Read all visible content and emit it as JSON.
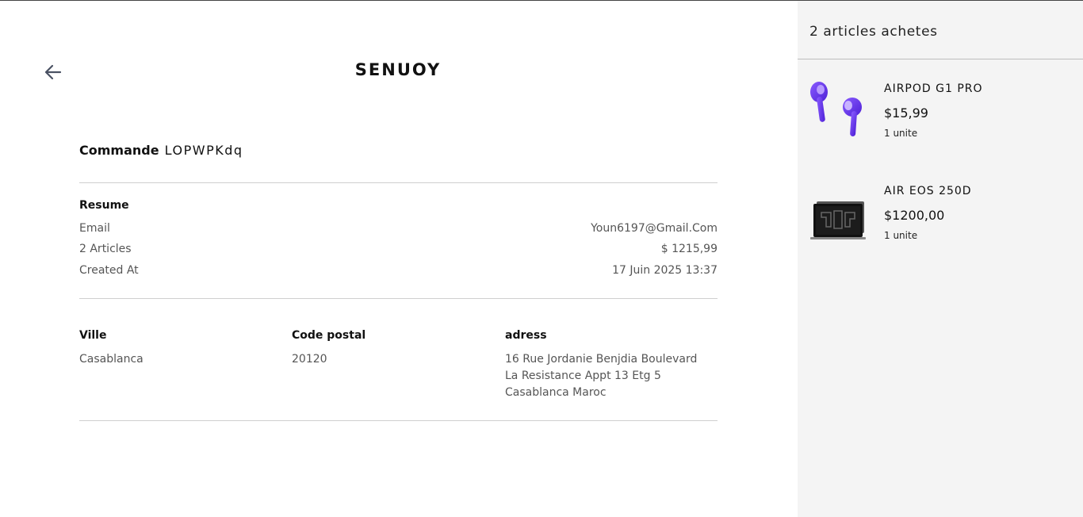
{
  "brand": "SENUOY",
  "order": {
    "label": "Commande",
    "number": "LOPWPKdq"
  },
  "summary": {
    "title": "Resume",
    "rows": [
      {
        "label": "Email",
        "value": "Youn6197@Gmail.Com"
      },
      {
        "label": "2 Articles",
        "value": "$ 1215,99"
      },
      {
        "label": "Created At",
        "value": "17 Juin 2025 13:37"
      }
    ]
  },
  "address": {
    "city_label": "Ville",
    "city": "Casablanca",
    "postal_label": "Code postal",
    "postal": "20120",
    "address_label": "adress",
    "address_lines": [
      "16 Rue Jordanie Benjdia Boulevard",
      "La Resistance Appt 13 Etg 5",
      "Casablanca Maroc"
    ]
  },
  "sidebar": {
    "title": "2 articles achetes",
    "items": [
      {
        "name": "AIRPOD G1 PRO",
        "price": "$15,99",
        "qty": "1 unite",
        "icon": "earbuds-icon",
        "color": "#6a3cf0"
      },
      {
        "name": "AIR EOS 250D",
        "price": "$1200,00",
        "qty": "1 unite",
        "icon": "laptop-icon",
        "color": "#1a1a1a"
      }
    ]
  },
  "colors": {
    "sidebar_bg": "#f4f4f4",
    "divider": "#cfcfcf",
    "accent_purple": "#6a3cf0"
  }
}
